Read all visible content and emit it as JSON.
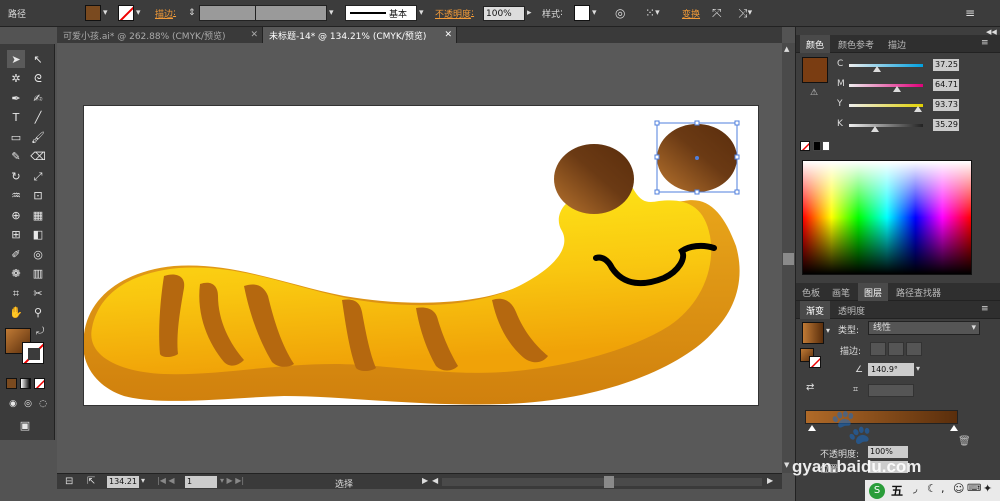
{
  "control_bar": {
    "object_type": "路径",
    "stroke_label": "描边",
    "stroke_style": "基本",
    "opacity_label": "不透明度",
    "opacity_value": "100%",
    "style_label": "样式",
    "transform_label": "变换",
    "fill_color": "#7a4a1f"
  },
  "tabs": [
    {
      "label": "可爱小孩.ai* @ 262.88% (CMYK/预览)",
      "active": false
    },
    {
      "label": "未标题-14* @ 134.21% (CMYK/预览)",
      "active": true
    }
  ],
  "status_bar": {
    "zoom": "134.21",
    "page": "1",
    "tool": "选择"
  },
  "color_panel": {
    "tabs": [
      "颜色",
      "颜色参考",
      "描边"
    ],
    "active_tab": "颜色",
    "swatch": "#7a3d12",
    "channels": [
      {
        "name": "C",
        "value": "37.25",
        "fraction": 0.3725,
        "color": "#00a0e0"
      },
      {
        "name": "M",
        "value": "64.71",
        "fraction": 0.6471,
        "color": "#e0007a"
      },
      {
        "name": "Y",
        "value": "93.73",
        "fraction": 0.9373,
        "color": "#e0d000"
      },
      {
        "name": "K",
        "value": "35.29",
        "fraction": 0.3529,
        "color": "#222222"
      }
    ]
  },
  "mid_panel": {
    "tabs": [
      "色板",
      "画笔",
      "图层",
      "路径查找器"
    ],
    "active_tab": "图层"
  },
  "gradient_panel": {
    "tabs": [
      "渐变",
      "透明度"
    ],
    "active_tab": "渐变",
    "type_label": "类型",
    "type_value": "线性",
    "stroke_label": "描边",
    "angle_value": "140.9°",
    "opacity_label": "不透明度",
    "opacity_value": "100%",
    "position_label": "位置"
  },
  "watermark": "gyan.baidu.com",
  "taskbar": {
    "ime_label": "五"
  }
}
